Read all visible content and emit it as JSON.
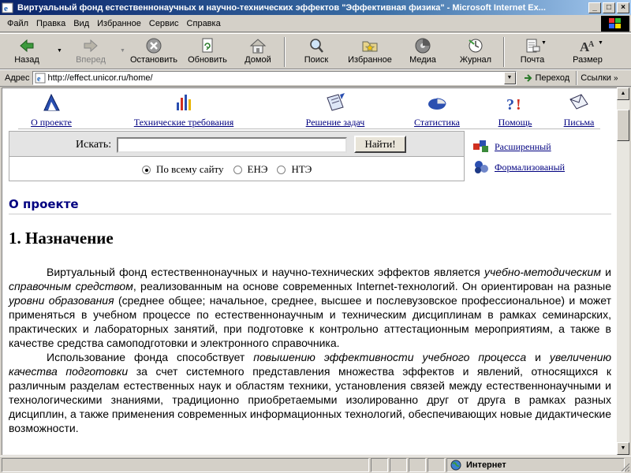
{
  "window": {
    "title": "Виртуальный фонд естественнонаучных и научно-технических эффектов \"Эффективная физика\" - Microsoft Internet Ex...",
    "buttons": {
      "minimize": "_",
      "maximize": "□",
      "close": "×"
    }
  },
  "menu": [
    "Файл",
    "Правка",
    "Вид",
    "Избранное",
    "Сервис",
    "Справка"
  ],
  "toolbar": {
    "back": "Назад",
    "forward": "Вперед",
    "stop": "Остановить",
    "refresh": "Обновить",
    "home": "Домой",
    "search": "Поиск",
    "favorites": "Избранное",
    "media": "Медиа",
    "history": "Журнал",
    "mail": "Почта",
    "size": "Размер"
  },
  "address": {
    "label": "Адрес",
    "url": "http://effect.unicor.ru/home/",
    "go": "Переход",
    "links": "Ссылки"
  },
  "site_nav": [
    {
      "label": "О проекте",
      "icon": "triangle-icon"
    },
    {
      "label": "Технические требования",
      "icon": "exclamation-icon"
    },
    {
      "label": "Решение задач",
      "icon": "notebook-icon"
    },
    {
      "label": "Статистика",
      "icon": "pie-chart-icon"
    },
    {
      "label": "Помощь",
      "icon": "help-question-icon"
    },
    {
      "label": "Письма",
      "icon": "envelope-icon"
    }
  ],
  "search": {
    "label": "Искать:",
    "value": "",
    "button": "Найти!",
    "scopes": [
      {
        "label": "По всему сайту",
        "checked": true
      },
      {
        "label": "ЕНЭ",
        "checked": false
      },
      {
        "label": "НТЭ",
        "checked": false
      }
    ],
    "advanced": "Расширенный",
    "formal": "Формализованый"
  },
  "article": {
    "section": "О проекте",
    "title": "1. Назначение",
    "p1": [
      "Виртуальный фонд естественнонаучных и научно-технических эффектов является ",
      "учебно-методическим",
      " и ",
      "справочным средством",
      ", реализованным на основе современных Internet-технологий. Он ориентирован на разные ",
      "уровни образования",
      " (среднее общее; начальное, среднее, высшее и послевузовское профессиональное) и может применяться в учебном процессе по естественнонаучным и техническим дисциплинам в рамках семинарских, практических и лабораторных занятий, при подготовке к контрольно аттестационным мероприятиям, а также в качестве средства самоподготовки и электронного справочника."
    ],
    "p2": [
      "Использование фонда способствует ",
      "повышению эффективности учебного процесса",
      " и ",
      "увеличению качества подготовки",
      " за счет системного представления множества эффектов и явлений, относящихся к различным разделам естественных наук и областям техники, установления связей между естественнонаучными и технологическими знаниями, традиционно приобретаемыми изолированно друг от друга в рамках разных дисциплин, а также применения современных информационных технологий, обеспечивающих новые дидактические возможности."
    ]
  },
  "status": {
    "zone": "Интернет"
  }
}
